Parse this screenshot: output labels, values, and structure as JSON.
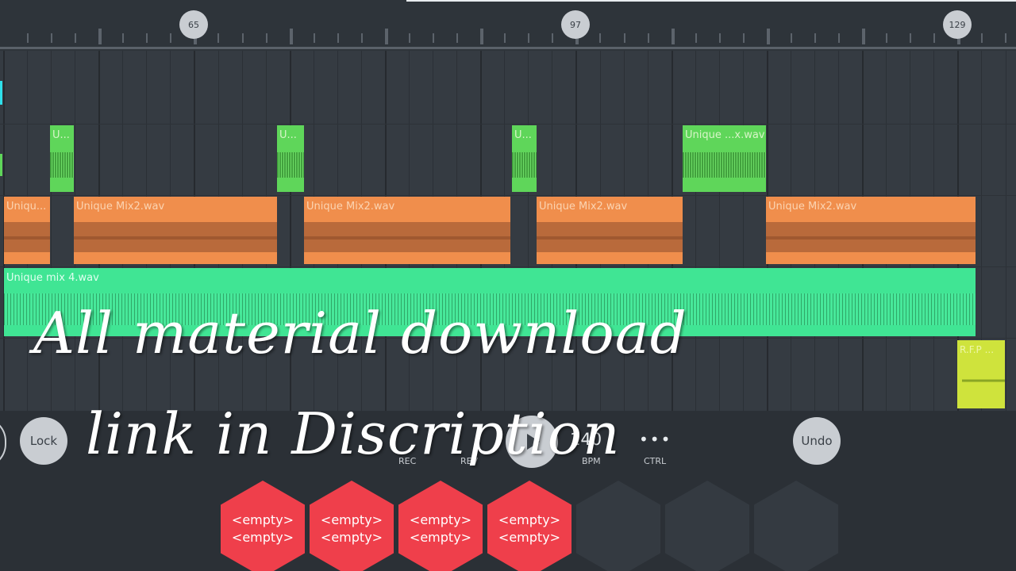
{
  "ruler": {
    "markers": [
      "65",
      "97",
      "129"
    ]
  },
  "playlist": {
    "clips": {
      "green_1": "U...",
      "green_2": "U...",
      "green_3": "U...",
      "green_4": "Unique ...x.wav",
      "orange_1": "Uniqu...",
      "orange_2": "Unique Mix2.wav",
      "orange_3": "Unique Mix2.wav",
      "orange_4": "Unique Mix2.wav",
      "orange_5": "Unique Mix2.wav",
      "teal_1": "Unique mix 4.wav",
      "yellow_1": "R.F.P ..."
    }
  },
  "overlay": {
    "line1": "All material download",
    "line2": "link in Discription"
  },
  "transport": {
    "lock_label": "Lock",
    "rec_label": "REC",
    "rev_label": "REV",
    "play_icon": "play-icon",
    "bpm_value": "140",
    "bpm_label": "BPM",
    "ctrl_dots": "•••",
    "ctrl_label": "CTRL",
    "undo_label": "Undo"
  },
  "pads": [
    {
      "line1": "<empty>",
      "line2": "<empty>"
    },
    {
      "line1": "<empty>",
      "line2": "<empty>"
    },
    {
      "line1": "<empty>",
      "line2": "<empty>"
    },
    {
      "line1": "<empty>",
      "line2": "<empty>"
    }
  ],
  "colors": {
    "background": "#2b3036",
    "pad_active": "#ef3f4b",
    "clip_green": "#5fd65a",
    "clip_orange": "#f08e4c",
    "clip_teal": "#40e594",
    "clip_yellow": "#cfe33c"
  }
}
